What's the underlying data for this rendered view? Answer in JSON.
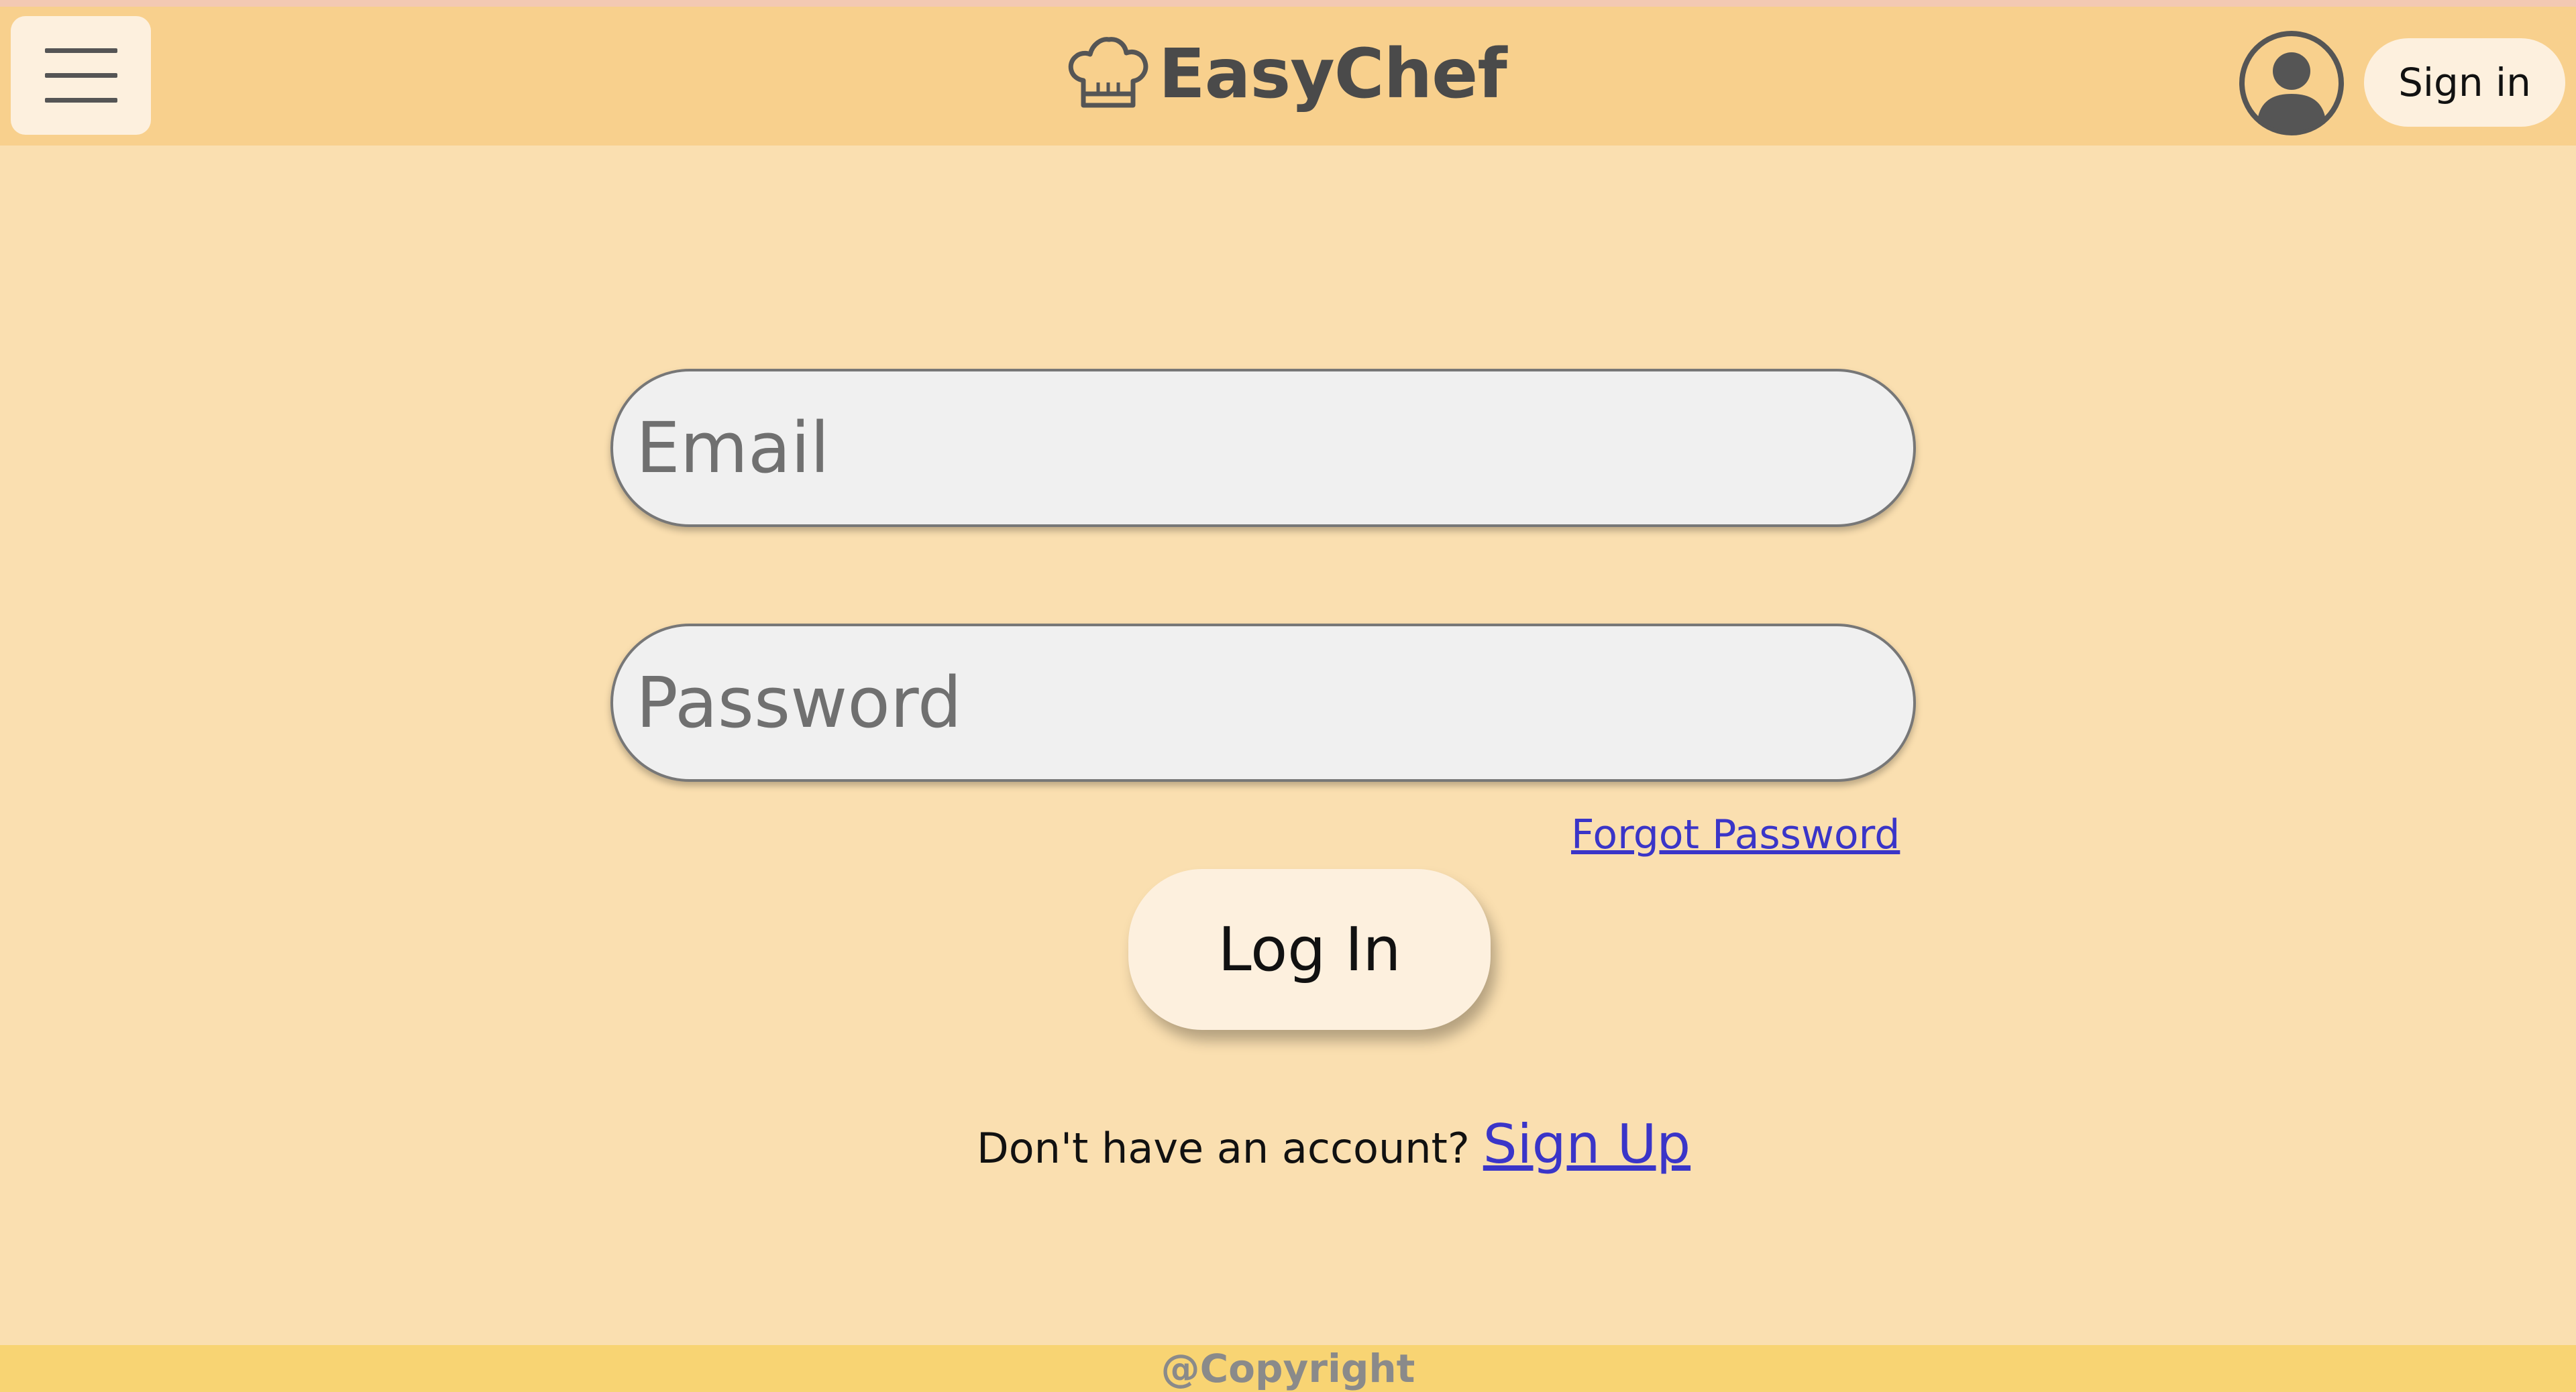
{
  "header": {
    "brand_name": "EasyChef",
    "signin_label": "Sign in",
    "logo_icon": "chef-hat-icon",
    "menu_icon": "hamburger-menu-icon",
    "avatar_icon": "user-avatar-icon"
  },
  "form": {
    "email_placeholder": "Email",
    "password_placeholder": "Password",
    "forgot_password": "Forgot Password",
    "login_label": "Log In",
    "no_account_text": "Don't have an account?",
    "signup_link": "Sign Up"
  },
  "footer": {
    "copyright": "@Copyright"
  },
  "colors": {
    "background": "#fadfb0",
    "header": "#f8d08d",
    "footer": "#f8d473",
    "button": "#fdf0de",
    "link": "#3a35c8"
  }
}
